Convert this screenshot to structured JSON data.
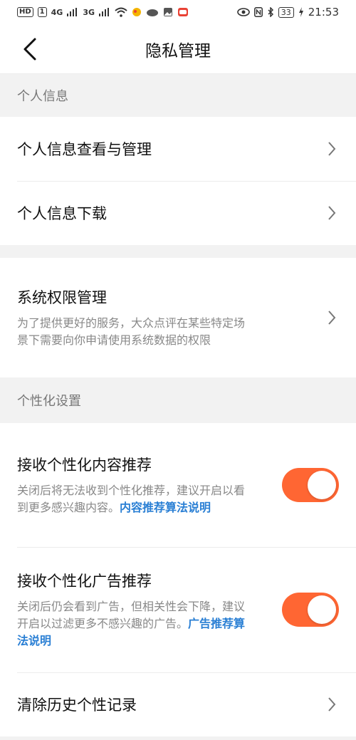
{
  "status_bar": {
    "hd_label": "HD",
    "sim1": "1",
    "net_4g": "4G",
    "net_3g": "3G",
    "battery": "33",
    "time": "21:53"
  },
  "nav": {
    "title": "隐私管理"
  },
  "sections": {
    "personal_info": {
      "header": "个人信息",
      "items": [
        {
          "label": "个人信息查看与管理"
        },
        {
          "label": "个人信息下载"
        }
      ]
    },
    "system": {
      "title": "系统权限管理",
      "description": "为了提供更好的服务，大众点评在某些特定场景下需要向你申请使用系统数据的权限"
    },
    "personalization": {
      "header": "个性化设置",
      "content": {
        "title": "接收个性化内容推荐",
        "description": "关闭后将无法收到个性化推荐，建议开启以看到更多感兴趣内容。",
        "link": "内容推荐算法说明",
        "enabled": true
      },
      "ads": {
        "title": "接收个性化广告推荐",
        "description": "关闭后仍会看到广告，但相关性会下降，建议开启以过滤更多不感兴趣的广告。",
        "link": "广告推荐算法说明",
        "enabled": true
      },
      "clear": {
        "label": "清除历史个性记录"
      }
    }
  },
  "colors": {
    "accent": "#ff6633",
    "link": "#2a7fd4"
  },
  "icons": [
    "back-arrow-icon",
    "chevron-right-icon",
    "wifi-icon",
    "signal-icon",
    "bluetooth-icon",
    "eye-icon",
    "nfc-icon"
  ]
}
